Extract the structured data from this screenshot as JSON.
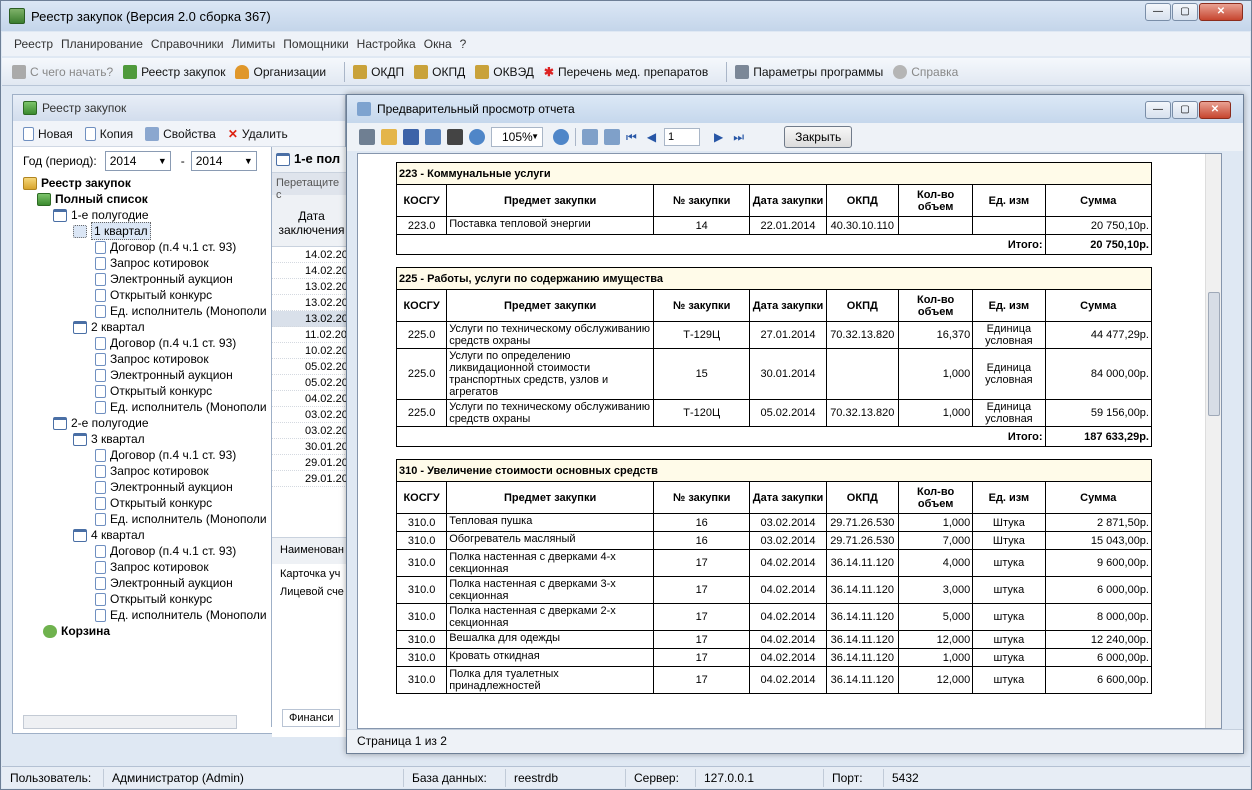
{
  "app": {
    "title": "Реестр закупок (Версия 2.0 сборка 367)"
  },
  "menu": [
    "Реестр",
    "Планирование",
    "Справочники",
    "Лимиты",
    "Помощники",
    "Настройка",
    "Окна",
    "?"
  ],
  "toolbar": {
    "start": "С чего начать?",
    "registry": "Реестр закупок",
    "orgs": "Организации",
    "okdp": "ОКДП",
    "okpd": "ОКПД",
    "okved": "ОКВЭД",
    "meds": "Перечень мед. препаратов",
    "params": "Параметры программы",
    "help": "Справка"
  },
  "left": {
    "title": "Реестр закупок",
    "tools": {
      "new": "Новая",
      "copy": "Копия",
      "props": "Свойства",
      "delete": "Удалить"
    },
    "year_label": "Год (период):",
    "year_from": "2014",
    "year_to": "2014",
    "dash": "-",
    "tree": {
      "root": "Реестр закупок",
      "full": "Полный список",
      "h1": "1-е полугодие",
      "q1": "1 квартал",
      "q2": "2 квартал",
      "h2": "2-е полугодие",
      "q3": "3 квартал",
      "q4": "4 квартал",
      "items": [
        "Договор (п.4 ч.1 ст. 93)",
        "Запрос котировок",
        "Электронный аукцион",
        "Открытый конкурс",
        "Ед. исполнитель (Монополи"
      ],
      "trash": "Корзина"
    }
  },
  "mid": {
    "header": "1-е пол",
    "drag": "Перетащите с",
    "col": "Дата заключения",
    "dates": [
      "14.02.20",
      "14.02.20",
      "13.02.20",
      "13.02.20",
      "13.02.20",
      "11.02.20",
      "10.02.20",
      "05.02.20",
      "05.02.20",
      "04.02.20",
      "03.02.20",
      "03.02.20",
      "30.01.20",
      "29.01.20",
      "29.01.20"
    ],
    "bottom_head": "Наименован",
    "bottom_rows": [
      "Карточка уч",
      "Лицевой сче"
    ],
    "tab": "Финанси"
  },
  "preview": {
    "title": "Предварительный просмотр отчета",
    "zoom": "105%",
    "page": "1",
    "close": "Закрыть",
    "status": "Страница 1 из 2",
    "cols": [
      "КОСГУ",
      "Предмет закупки",
      "№ закупки",
      "Дата закупки",
      "ОКПД",
      "Кол-во объем",
      "Ед. изм",
      "Сумма"
    ],
    "total_label": "Итого:",
    "sections": [
      {
        "title": "223 - Коммунальные услуги",
        "total": "20 750,10р.",
        "rows": [
          [
            "223.0",
            "Поставка тепловой энергии",
            "14",
            "22.01.2014",
            "40.30.10.110",
            "",
            "",
            "20 750,10р."
          ]
        ]
      },
      {
        "title": "225 - Работы, услуги по содержанию имущества",
        "total": "187 633,29р.",
        "rows": [
          [
            "225.0",
            "Услуги по техническому обслуживанию средств охраны",
            "Т-129Ц",
            "27.01.2014",
            "70.32.13.820",
            "16,370",
            "Единица условная",
            "44 477,29р."
          ],
          [
            "225.0",
            "Услуги по определению ликвидационной стоимости транспортных средств, узлов и агрегатов",
            "15",
            "30.01.2014",
            "",
            "1,000",
            "Единица условная",
            "84 000,00р."
          ],
          [
            "225.0",
            "Услуги по техническому обслуживанию средств охраны",
            "Т-120Ц",
            "05.02.2014",
            "70.32.13.820",
            "1,000",
            "Единица условная",
            "59 156,00р."
          ]
        ]
      },
      {
        "title": "310 - Увеличение стоимости основных средств",
        "total": "",
        "rows": [
          [
            "310.0",
            "Тепловая пушка",
            "16",
            "03.02.2014",
            "29.71.26.530",
            "1,000",
            "Штука",
            "2 871,50р."
          ],
          [
            "310.0",
            "Обогреватель масляный",
            "16",
            "03.02.2014",
            "29.71.26.530",
            "7,000",
            "Штука",
            "15 043,00р."
          ],
          [
            "310.0",
            "Полка настенная с дверками 4-х секционная",
            "17",
            "04.02.2014",
            "36.14.11.120",
            "4,000",
            "штука",
            "9 600,00р."
          ],
          [
            "310.0",
            "Полка настенная с дверками 3-х секционная",
            "17",
            "04.02.2014",
            "36.14.11.120",
            "3,000",
            "штука",
            "6 000,00р."
          ],
          [
            "310.0",
            "Полка настенная с дверками 2-х секционная",
            "17",
            "04.02.2014",
            "36.14.11.120",
            "5,000",
            "штука",
            "8 000,00р."
          ],
          [
            "310.0",
            "Вешалка для одежды",
            "17",
            "04.02.2014",
            "36.14.11.120",
            "12,000",
            "штука",
            "12 240,00р."
          ],
          [
            "310.0",
            "Кровать откидная",
            "17",
            "04.02.2014",
            "36.14.11.120",
            "1,000",
            "штука",
            "6 000,00р."
          ],
          [
            "310.0",
            "Полка для туалетных принадлежностей",
            "17",
            "04.02.2014",
            "36.14.11.120",
            "12,000",
            "штука",
            "6 600,00р."
          ]
        ]
      }
    ]
  },
  "status": {
    "user_label": "Пользователь:",
    "user": "Администратор (Admin)",
    "db_label": "База данных:",
    "db": "reestrdb",
    "server_label": "Сервер:",
    "server": "127.0.0.1",
    "port_label": "Порт:",
    "port": "5432"
  }
}
